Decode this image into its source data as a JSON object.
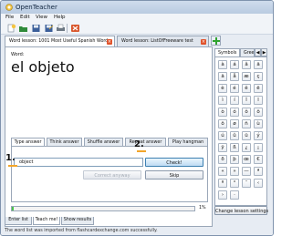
{
  "window": {
    "title": "OpenTeacher"
  },
  "menu": [
    "File",
    "Edit",
    "View",
    "Help"
  ],
  "toolbar": {
    "icons": [
      "new-lesson-icon",
      "open-icon",
      "save-icon",
      "save-as-icon",
      "print-icon",
      "quit-icon"
    ]
  },
  "doc_tabs": [
    {
      "label": "Word lesson: 1001 Most Useful Spanish Words",
      "active": true
    },
    {
      "label": "Word lesson: ListOfFreeware test",
      "active": false
    }
  ],
  "lesson": {
    "word_label": "Word:",
    "word": "el objeto"
  },
  "inner_tabs": [
    "Type answer",
    "Think answer",
    "Shuffle answer",
    "Repeat answer",
    "Play hangman"
  ],
  "answer": {
    "value": "object",
    "check_label": "Check!",
    "correct_label": "Correct anyway",
    "skip_label": "Skip"
  },
  "steps": {
    "one": "1.",
    "two": "2."
  },
  "progress": {
    "value": 0.01,
    "text": "1%"
  },
  "side": {
    "tabs": [
      "Symbols",
      "Gree"
    ],
    "arrows": [
      "◀",
      "▶"
    ],
    "symbols": [
      [
        "à",
        "á",
        "â",
        "ä"
      ],
      [
        "ã",
        "å",
        "æ",
        "ç"
      ],
      [
        "è",
        "é",
        "ê",
        "ë"
      ],
      [
        "ì",
        "í",
        "î",
        "ï"
      ],
      [
        "ò",
        "ó",
        "ô",
        "õ"
      ],
      [
        "ö",
        "ø",
        "ñ",
        "ù"
      ],
      [
        "ú",
        "û",
        "ü",
        "ý"
      ],
      [
        "ÿ",
        "ß",
        "¿",
        "¡"
      ],
      [
        "ð",
        "þ",
        "œ",
        "€"
      ],
      [
        "«",
        "»",
        "—",
        "ª"
      ],
      [
        "º",
        "°",
        "¨",
        "‹"
      ],
      [
        "›",
        "·",
        "",
        ""
      ]
    ],
    "settings_label": "Change lesson settings"
  },
  "bottom_tabs": [
    "Enter list",
    "Teach me!",
    "Show results"
  ],
  "status": "The word list was imported from flashcardexchange.com successfully.",
  "colors": {
    "accent": "#f2a52a",
    "progress": "#4cc24c",
    "title_bar": "#c6d6ea"
  }
}
